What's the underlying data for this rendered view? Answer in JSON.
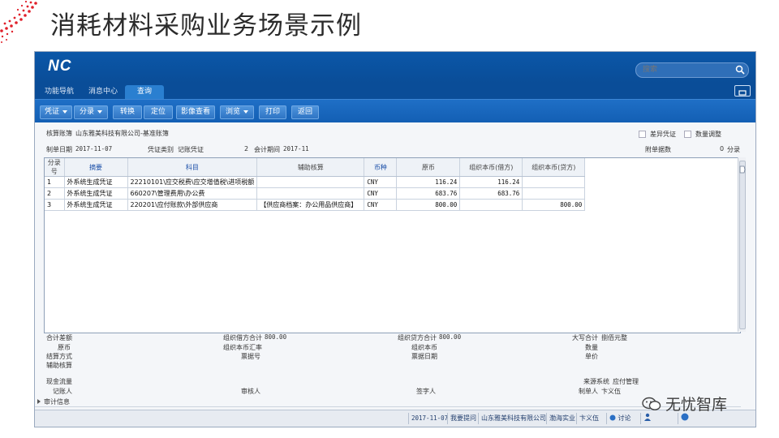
{
  "slide": {
    "title": "消耗材料采购业务场景示例"
  },
  "app": {
    "logo": "NC",
    "search_placeholder": "搜索",
    "nav_tabs": [
      {
        "label": "功能导航"
      },
      {
        "label": "消息中心"
      },
      {
        "label": "查询",
        "active": true
      }
    ],
    "toolbar": [
      {
        "label": "凭证",
        "dropdown": true
      },
      {
        "label": "分录",
        "dropdown": true
      },
      {
        "label": "转换"
      },
      {
        "label": "定位"
      },
      {
        "label": "影像查看"
      },
      {
        "label": "浏览",
        "dropdown": true
      },
      {
        "label": "打印"
      },
      {
        "label": "返回"
      }
    ],
    "header": {
      "account_book_label": "核算账簿",
      "account_book_value": "山东雅美科技有限公司-基准账簿",
      "diff_voucher_label": "差异凭证",
      "qty_adjust_label": "数量调整",
      "date_label": "制单日期",
      "date_value": "2017-11-07",
      "voucher_type_label": "凭证类别",
      "voucher_type_value": "记账凭证",
      "voucher_no": "2",
      "period_label": "会计期间",
      "period_value": "2017-11",
      "attach_label": "附单据数",
      "attach_value": "0",
      "entry_label": "分录"
    },
    "table": {
      "columns": [
        "分录号",
        "摘要",
        "科目",
        "辅助核算",
        "币种",
        "原币",
        "组织本币(借方)",
        "组织本币(贷方)"
      ],
      "rows": [
        [
          "1",
          "外系统生成凭证",
          "22210101\\应交税费\\应交增值税\\进项税额",
          "",
          "CNY",
          "116.24",
          "116.24",
          ""
        ],
        [
          "2",
          "外系统生成凭证",
          "660207\\管理费用\\办公费",
          "",
          "CNY",
          "683.76",
          "683.76",
          ""
        ],
        [
          "3",
          "外系统生成凭证",
          "220201\\应付账款\\外部供应商",
          "【供应商档案：办公用品供应商】",
          "CNY",
          "800.00",
          "",
          "800.00"
        ]
      ]
    },
    "footer": {
      "total_diff_label": "合计差额",
      "debit_total_label": "组织借方合计",
      "debit_total_value": "800.00",
      "credit_total_label": "组织贷方合计",
      "credit_total_value": "800.00",
      "capital_label": "大写合计",
      "capital_value": "捌佰元整",
      "orig_label": "原币",
      "rate_label": "组织本币汇率",
      "local_label": "组织本币",
      "qty_label": "数量",
      "settle_label": "结算方式",
      "bill_no_label": "票据号",
      "bill_date_label": "票据日期",
      "price_label": "单价",
      "aux_label": "辅助核算",
      "cashflow_label": "现金流量",
      "source_label": "来源系统",
      "source_value": "应付管理",
      "booker_label": "记账人",
      "reviewer_label": "审核人",
      "signer_label": "签字人",
      "maker_label": "制单人",
      "maker_value": "卞义伍",
      "audit_info_label": "审计信息"
    },
    "statusbar": {
      "date": "2017-11-07",
      "feedback": "我要提问",
      "company": "山东雅美科技有限公司",
      "group": "渤海实业",
      "user": "卞义伍",
      "discuss": "讨论"
    }
  },
  "watermark": {
    "text": "无忧智库"
  },
  "colors": {
    "brand_blue": "#0b57a8",
    "toolbar_blue": "#1f6fc6",
    "accent_red": "#e0202a"
  }
}
